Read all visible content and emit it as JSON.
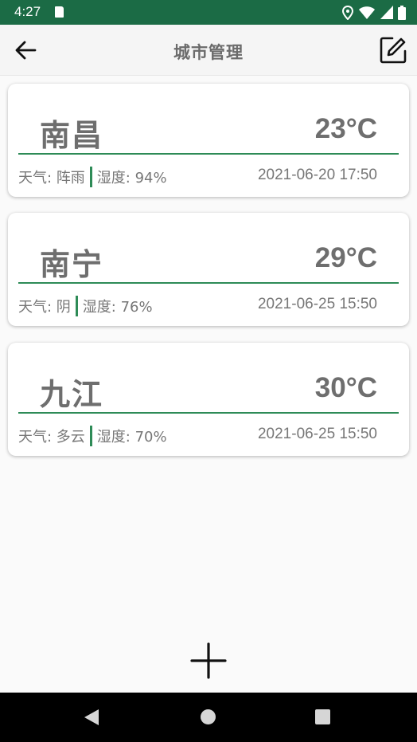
{
  "status_bar": {
    "time": "4:27"
  },
  "app_bar": {
    "title": "城市管理"
  },
  "cities": [
    {
      "name": "南昌",
      "temp": "23°C",
      "weather": "天气: 阵雨",
      "humidity": "湿度: 94%",
      "time": "2021-06-20 17:50"
    },
    {
      "name": "南宁",
      "temp": "29°C",
      "weather": "天气: 阴",
      "humidity": "湿度: 76%",
      "time": "2021-06-25 15:50"
    },
    {
      "name": "九江",
      "temp": "30°C",
      "weather": "天气: 多云",
      "humidity": "湿度: 70%",
      "time": "2021-06-25 15:50"
    }
  ],
  "colors": {
    "status_bar": "#1b6b45",
    "accent": "#2e8b57",
    "text": "#6e6e6e"
  },
  "icons": [
    "back-arrow-icon",
    "edit-icon",
    "plus-icon",
    "nav-back-icon",
    "nav-home-icon",
    "nav-recent-icon"
  ]
}
